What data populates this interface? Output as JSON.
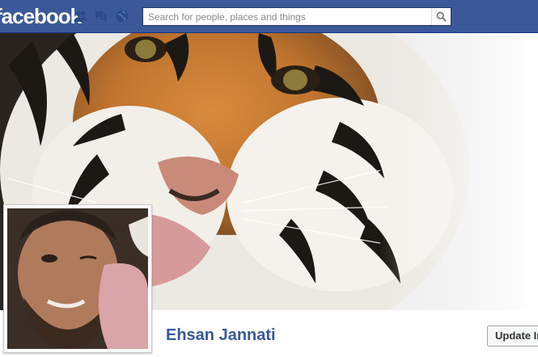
{
  "header": {
    "logo_text": "facebook",
    "jewels": [
      "friend-requests-icon",
      "messages-icon",
      "notifications-icon"
    ],
    "search": {
      "placeholder": "Search for people, places and things",
      "value": ""
    },
    "brand_color": "#3b5998"
  },
  "cover": {
    "subject": "tiger-cover-photo"
  },
  "profile": {
    "name": "Ehsan Jannati",
    "update_button_label": "Update Info"
  }
}
